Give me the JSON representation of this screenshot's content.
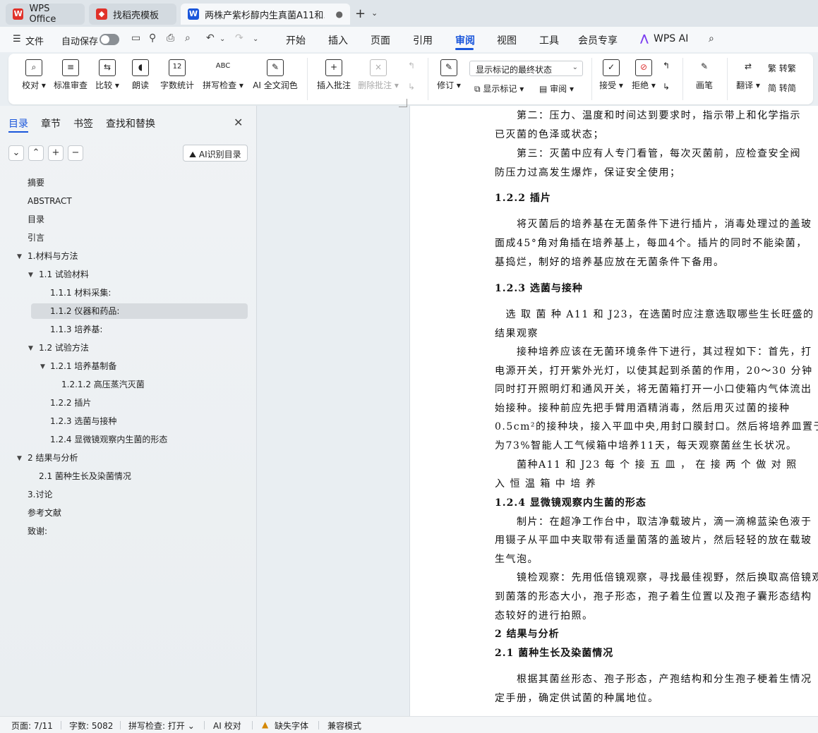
{
  "tabs": [
    {
      "label": "WPS Office",
      "logo_color": "#e0322a"
    },
    {
      "label": "找稻壳模板",
      "logo_color": "#e0322a"
    },
    {
      "label": "两株产紫杉醇内生真菌A11和...",
      "logo_color": "#1a56db"
    }
  ],
  "menu": {
    "file": "文件",
    "autosave": "自动保存",
    "items": [
      "开始",
      "插入",
      "页面",
      "引用",
      "审阅",
      "视图",
      "工具",
      "会员专享",
      "WPS AI"
    ],
    "active": "审阅"
  },
  "ribbon": {
    "proofread": "校对",
    "standard_review": "标准审查",
    "compare": "比较",
    "read_aloud": "朗读",
    "word_count": "字数统计",
    "spell_check": "拼写检查",
    "ai_polish": "AI 全文润色",
    "insert_comment": "插入批注",
    "delete_comment": "删除批注",
    "revise": "修订",
    "show_markup_select": "显示标记的最终状态",
    "show_markup": "显示标记",
    "review": "审阅",
    "accept": "接受",
    "reject": "拒绝",
    "brush": "画笔",
    "translate": "翻译",
    "to_traditional": "转繁",
    "to_simplified": "转简"
  },
  "panel": {
    "tabs": [
      "目录",
      "章节",
      "书签",
      "查找和替换"
    ],
    "ai_button": "AI识别目录",
    "toc": [
      {
        "label": "摘要",
        "level": 0
      },
      {
        "label": "ABSTRACT",
        "level": 0
      },
      {
        "label": "目录",
        "level": 0
      },
      {
        "label": "引言",
        "level": 0
      },
      {
        "label": "1.材料与方法",
        "level": 0
      },
      {
        "label": "1.1 试验材料",
        "level": 1
      },
      {
        "label": "1.1.1 材料采集:",
        "level": 2
      },
      {
        "label": "1.1.2 仪器和药品:",
        "level": 2
      },
      {
        "label": "1.1.3  培养基:",
        "level": 2
      },
      {
        "label": "1.2 试验方法",
        "level": 1
      },
      {
        "label": "1.2.1 培养基制备",
        "level": 2
      },
      {
        "label": "1.2.1.2  高压蒸汽灭菌",
        "level": 3
      },
      {
        "label": "1.2.2  插片",
        "level": 2
      },
      {
        "label": "1.2.3 选菌与接种",
        "level": 2
      },
      {
        "label": "1.2.4  显微镜观察内生菌的形态",
        "level": 2
      },
      {
        "label": "2 结果与分析",
        "level": 0
      },
      {
        "label": "2.1  菌种生长及染菌情况",
        "level": 1
      },
      {
        "label": "3.讨论",
        "level": 0
      },
      {
        "label": "参考文献",
        "level": 0
      },
      {
        "label": "致谢:",
        "level": 0
      }
    ]
  },
  "document": {
    "lines": [
      "　　第二：压力、温度和时间达到要求时，指示带上和化学指示",
      "已灭菌的色泽或状态；",
      "　　第三：灭菌中应有人专门看管，每次灭菌前，应检查安全阀",
      "防压力过高发生爆炸，保证安全使用；",
      "1.2.2 插片",
      "　　将灭菌后的培养基在无菌条件下进行插片，消毒处理过的盖玻",
      "面成45°角对角插在培养基上，每皿4个。插片的同时不能染菌，",
      "基捣烂，制好的培养基应放在无菌条件下备用。",
      "1.2.3 选菌与接种",
      "　选 取 菌 种  A11 和 J23，在选菌时应注意选取哪些生长旺盛的",
      "结果观察",
      "　　接种培养应该在无菌环境条件下进行，其过程如下：首先，打",
      "电源开关，打开紫外光灯，以使其起到杀菌的作用，20～30 分钟",
      "同时打开照明灯和通风开关，将无菌箱打开一小口使箱内气体流出",
      "始接种。接种前应先把手臂用酒精消毒，然后用灭过菌的接种",
      "0.5cm²的接种块，接入平皿中央,用封口膜封口。然后将培养皿置于",
      "为73%智能人工气候箱中培养11天，每天观察菌丝生长状况。",
      "　　菌种A11  和  J23  每 个 接 五 皿 ，  在 接 两 个 做 对 照",
      "入 恒 温 箱 中 培 养",
      "1.2.4 显微镜观察内生菌的形态",
      "　　制片：在超净工作台中，取洁净载玻片，滴一滴棉蓝染色液于",
      "用镊子从平皿中夹取带有适量菌落的盖玻片，然后轻轻的放在载玻",
      "生气泡。",
      "　　镜检观察：先用低倍镜观察，寻找最佳视野，然后换取高倍镜观",
      "到菌落的形态大小，孢子形态，孢子着生位置以及孢子囊形态结构",
      "态较好的进行拍照。",
      "2 结果与分析",
      "2.1 菌种生长及染菌情况",
      "　　根据其菌丝形态、孢子形态，产孢结构和分生孢子梗着生情况",
      "定手册，确定供试菌的种属地位。"
    ]
  },
  "status": {
    "page": "页面: 7/11",
    "words": "字数: 5082",
    "spell": "拼写检查: 打开",
    "ai_proof": "AI 校对",
    "missing_font": "缺失字体",
    "compat": "兼容模式"
  }
}
